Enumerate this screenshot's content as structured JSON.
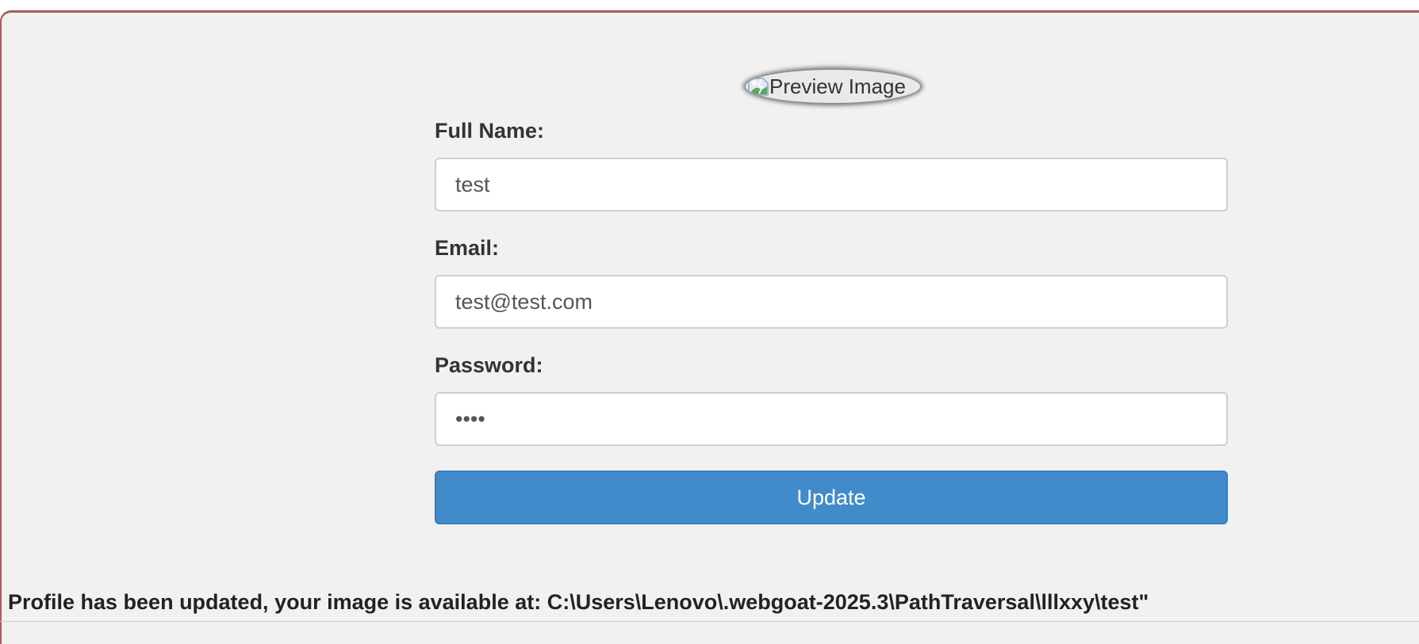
{
  "preview": {
    "alt_text": "Preview Image",
    "icon": "broken-image-icon"
  },
  "form": {
    "full_name_label": "Full Name:",
    "full_name_value": "test",
    "email_label": "Email:",
    "email_value": "test@test.com",
    "password_label": "Password:",
    "password_value": "test",
    "update_label": "Update"
  },
  "status": {
    "message": "Profile has been updated, your image is available at: C:\\Users\\Lenovo\\.webgoat-2025.3\\PathTraversal\\lllxxy\\test\""
  },
  "colors": {
    "panel_border": "#b0585f",
    "panel_background": "#f1f1f1",
    "button": "#428bca"
  }
}
